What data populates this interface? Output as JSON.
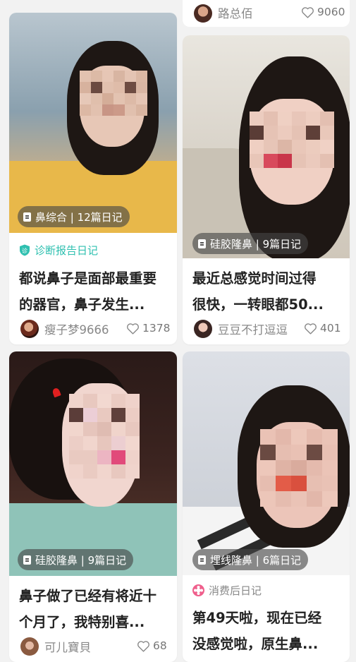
{
  "top_strip": {
    "author": "路总佰",
    "likes": "9060"
  },
  "cards": [
    {
      "tag": "鼻综合 | 12篇日记",
      "label": "诊断报告日记",
      "label_color": "#2fc0b0",
      "title_line1": "都说鼻子是面部最重要",
      "title_line2": "的器官，鼻子发生...",
      "author": "瘦子梦9666",
      "likes": "1378"
    },
    {
      "tag": "硅胶隆鼻 | 9篇日记",
      "title_line1": "最近总感觉时间过得",
      "title_line2": "很快，一转眼都50...",
      "author": "豆豆不打逗逗",
      "likes": "401"
    },
    {
      "tag": "硅胶隆鼻 | 9篇日记",
      "title_line1": "鼻子做了已经有将近十",
      "title_line2": "个月了，我特别喜...",
      "author": "可儿寶貝",
      "likes": "68"
    },
    {
      "tag": "埋线隆鼻 | 6篇日记",
      "label": "消费后日记",
      "label_color": "#ef5f8c",
      "title_line1": "第49天啦，现在已经",
      "title_line2": "没感觉啦，原生鼻..."
    }
  ]
}
